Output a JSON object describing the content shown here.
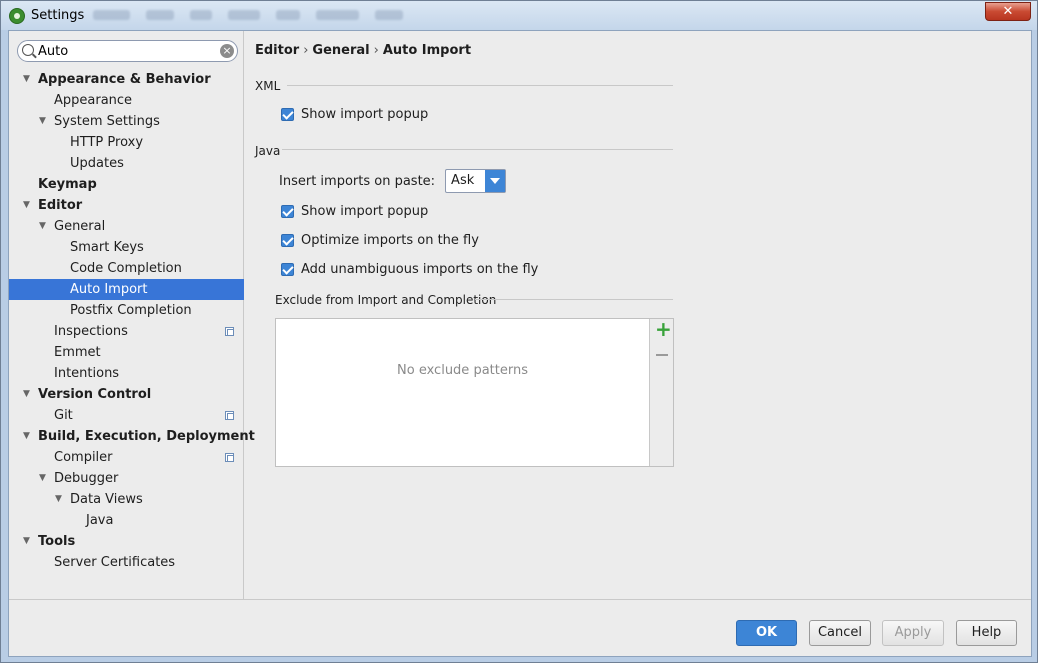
{
  "window": {
    "title": "Settings",
    "close_glyph": "✕"
  },
  "search": {
    "value": "Auto",
    "clear_glyph": "×"
  },
  "tree": [
    {
      "label": "Appearance & Behavior",
      "level": 0,
      "bold": true,
      "expanded": true
    },
    {
      "label": "Appearance",
      "level": 1
    },
    {
      "label": "System Settings",
      "level": 1,
      "expanded": true
    },
    {
      "label": "HTTP Proxy",
      "level": 2
    },
    {
      "label": "Updates",
      "level": 2
    },
    {
      "label": "Keymap",
      "level": 0,
      "bold": true
    },
    {
      "label": "Editor",
      "level": 0,
      "bold": true,
      "expanded": true
    },
    {
      "label": "General",
      "level": 1,
      "expanded": true
    },
    {
      "label": "Smart Keys",
      "level": 2
    },
    {
      "label": "Code Completion",
      "level": 2
    },
    {
      "label": "Auto Import",
      "level": 2,
      "selected": true
    },
    {
      "label": "Postfix Completion",
      "level": 2
    },
    {
      "label": "Inspections",
      "level": 1,
      "project_icon": true
    },
    {
      "label": "Emmet",
      "level": 1
    },
    {
      "label": "Intentions",
      "level": 1
    },
    {
      "label": "Version Control",
      "level": 0,
      "bold": true,
      "expanded": true
    },
    {
      "label": "Git",
      "level": 1,
      "project_icon": true
    },
    {
      "label": "Build, Execution, Deployment",
      "level": 0,
      "bold": true,
      "expanded": true
    },
    {
      "label": "Compiler",
      "level": 1,
      "project_icon": true
    },
    {
      "label": "Debugger",
      "level": 1,
      "expanded": true
    },
    {
      "label": "Data Views",
      "level": 2,
      "expanded": true
    },
    {
      "label": "Java",
      "level": 3
    },
    {
      "label": "Tools",
      "level": 0,
      "bold": true,
      "expanded": true
    },
    {
      "label": "Server Certificates",
      "level": 1
    }
  ],
  "breadcrumb": {
    "part1": "Editor",
    "part2": "General",
    "part3": "Auto Import",
    "sep": "›"
  },
  "xml": {
    "section_label": "XML",
    "show_import_popup": {
      "label": "Show import popup",
      "checked": true
    }
  },
  "java": {
    "section_label": "Java",
    "insert_imports_label": "Insert imports on paste:",
    "insert_imports_value": "Ask",
    "show_import_popup": {
      "label": "Show import popup",
      "checked": true
    },
    "optimize_imports": {
      "label": "Optimize imports on the fly",
      "checked": true
    },
    "add_unambiguous": {
      "label": "Add unambiguous imports on the fly",
      "checked": true
    }
  },
  "exclude": {
    "section_label": "Exclude from Import and Completion",
    "empty_text": "No exclude patterns",
    "add_glyph": "+"
  },
  "buttons": {
    "ok": "OK",
    "cancel": "Cancel",
    "apply": "Apply",
    "help": "Help"
  },
  "colors": {
    "accent": "#3d85d6",
    "selection": "#3875d7",
    "add_green": "#38a23a"
  }
}
